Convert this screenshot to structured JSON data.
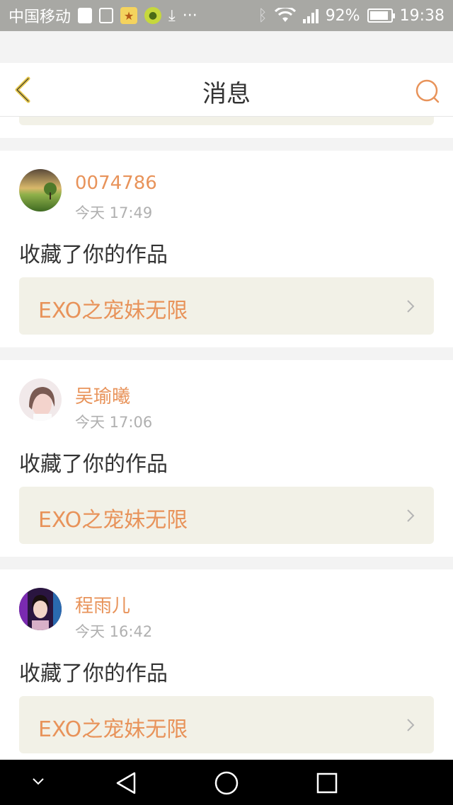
{
  "status_bar": {
    "carrier": "中国移动",
    "battery_pct": "92%",
    "battery_level": 0.92,
    "time": "19:38",
    "icons": [
      "sim-icon",
      "image-icon",
      "star-app-icon",
      "green-app-icon",
      "download-icon",
      "more-dots-icon",
      "bluetooth-icon",
      "wifi-icon",
      "signal-icon",
      "battery-icon"
    ]
  },
  "header": {
    "title": "消息",
    "back_icon": "chevron-left-icon",
    "search_icon": "search-icon",
    "accent_color": "#e8935a",
    "back_color": "#e6c74a"
  },
  "messages": [
    {
      "username": "0074786",
      "time": "今天 17:49",
      "text": "收藏了你的作品",
      "work_title": "EXO之宠妹无限"
    },
    {
      "username": "吴瑜曦",
      "time": "今天 17:06",
      "text": "收藏了你的作品",
      "work_title": "EXO之宠妹无限"
    },
    {
      "username": "程雨儿",
      "time": "今天 16:42",
      "text": "收藏了你的作品",
      "work_title": "EXO之宠妹无限"
    }
  ],
  "system_nav": {
    "icons": [
      "hide-keyboard-icon",
      "back-triangle-icon",
      "home-circle-icon",
      "recents-square-icon"
    ]
  }
}
